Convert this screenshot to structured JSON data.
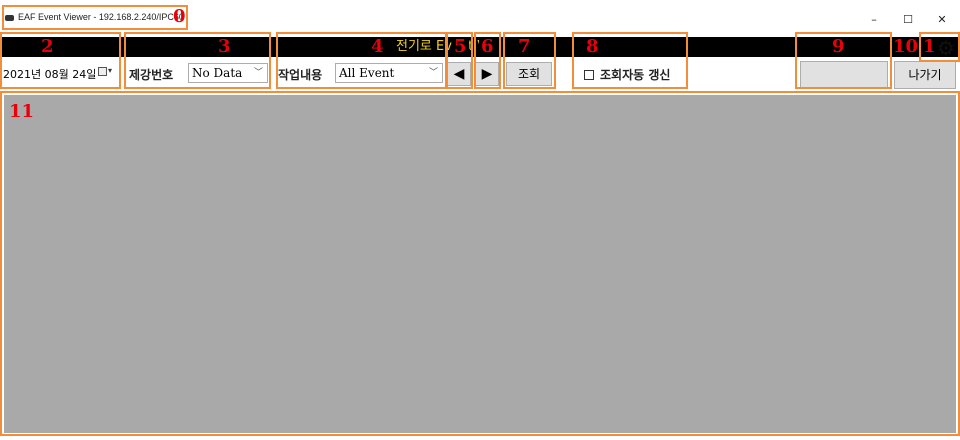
{
  "window": {
    "title": "EAF Event Viewer - 192.168.2.240/IPC60",
    "minimize": "–",
    "maximize": "☐",
    "close": "✕"
  },
  "banner": {
    "title": "전기로 Event V",
    "color": "#f2cf1d"
  },
  "toolbar": {
    "date_value": "2021년 08월 24일",
    "steel_no_label": "제강번호",
    "steel_no_value": "No Data",
    "work_label": "작업내용",
    "work_value": "All Event",
    "prev_glyph": "◀",
    "next_glyph": "▶",
    "query_label": "조회",
    "auto_refresh_label": "조회자동 갱신",
    "status_value": "",
    "exit_label": "나가기",
    "settings_icon": "gear-icon"
  },
  "annotations": {
    "a0": "0",
    "a1": "1",
    "a2": "2",
    "a3": "3",
    "a4": "4",
    "a5": "5",
    "a6": "6",
    "a7": "7",
    "a8": "8",
    "a9": "9",
    "a10": "10",
    "a11": "11"
  },
  "colors": {
    "annotation_border": "#f28d3a",
    "annotation_number": "#e8000b",
    "content_background": "#a9a9a9"
  }
}
